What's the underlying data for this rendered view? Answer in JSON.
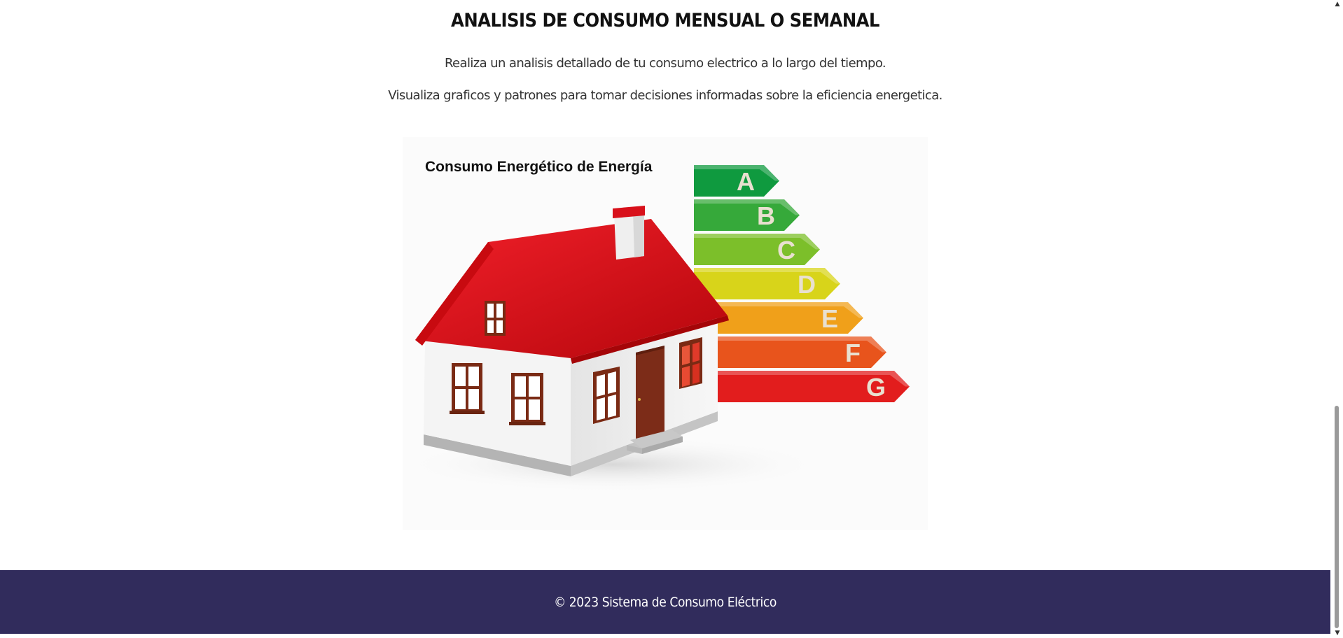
{
  "section": {
    "title": "ANALISIS DE CONSUMO MENSUAL O SEMANAL",
    "description_1": "Realiza un analisis detallado de tu consumo electrico a lo largo del tiempo.",
    "description_2": "Visualiza graficos y patrones para tomar decisiones informadas sobre la eficiencia energetica."
  },
  "illustration": {
    "caption": "Consumo Energético de Energía",
    "energy_classes": [
      "A",
      "B",
      "C",
      "D",
      "E",
      "F",
      "G"
    ],
    "class_colors": [
      "#0f9a3f",
      "#36a93a",
      "#7cbf2a",
      "#d8d41a",
      "#f0a01a",
      "#e8541c",
      "#e21d1d"
    ]
  },
  "footer": {
    "text": "© 2023 Sistema de Consumo Eléctrico"
  },
  "colors": {
    "footer_bg": "#312c5c",
    "roof": "#e00b12",
    "wall": "#f2f2f2",
    "door": "#7c2c18"
  }
}
